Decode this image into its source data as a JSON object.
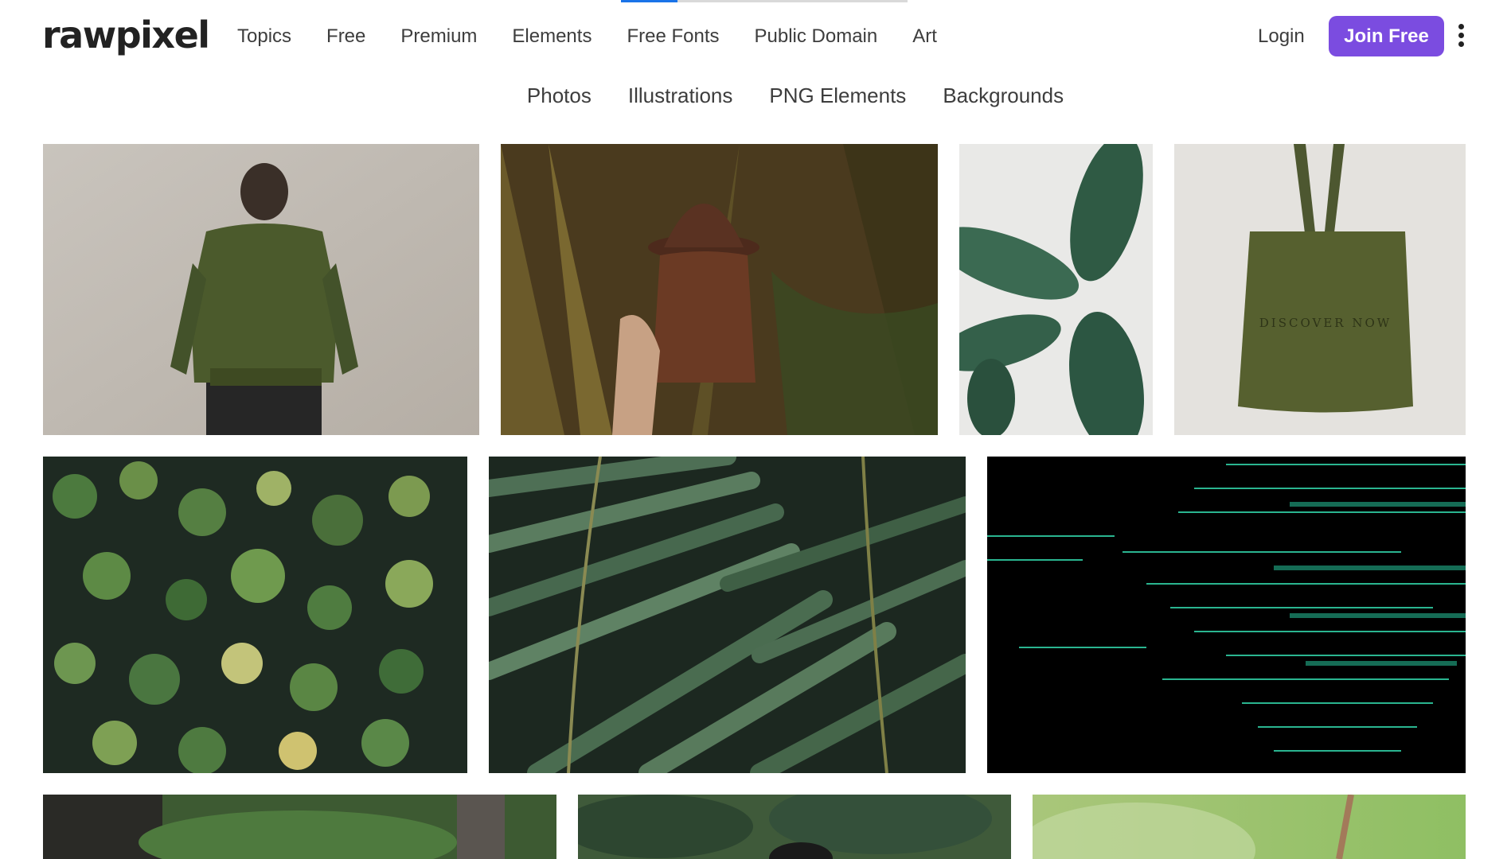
{
  "brand": {
    "logo_text": "rawpixel"
  },
  "main_nav": {
    "items": [
      {
        "label": "Topics"
      },
      {
        "label": "Free"
      },
      {
        "label": "Premium"
      },
      {
        "label": "Elements"
      },
      {
        "label": "Free Fonts"
      },
      {
        "label": "Public Domain"
      },
      {
        "label": "Art"
      }
    ]
  },
  "account": {
    "login_label": "Login",
    "join_label": "Join Free",
    "join_color": "#7b4ce0",
    "more_icon": "kebab-menu-icon"
  },
  "sub_nav": {
    "items": [
      {
        "label": "Photos"
      },
      {
        "label": "Illustrations"
      },
      {
        "label": "PNG Elements"
      },
      {
        "label": "Backgrounds"
      }
    ]
  },
  "gallery": {
    "tote_bag_text": "DISCOVER NOW"
  }
}
